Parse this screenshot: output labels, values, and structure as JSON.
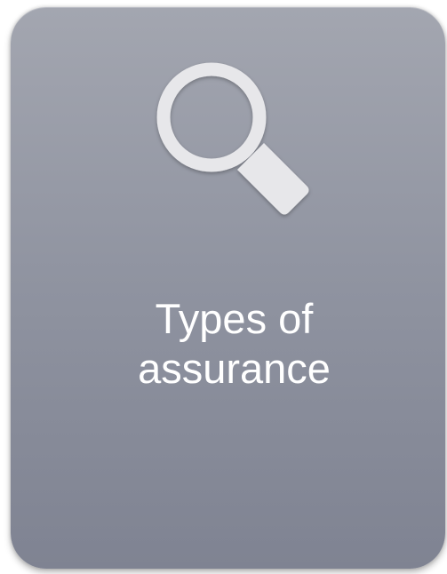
{
  "card": {
    "title_line1": "Types of",
    "title_line2": "assurance",
    "icon": "search-icon",
    "colors": {
      "card_top": "#a3a6b0",
      "card_bottom": "#7f8392",
      "text": "#ffffff",
      "icon": "#e7e7ea"
    }
  }
}
